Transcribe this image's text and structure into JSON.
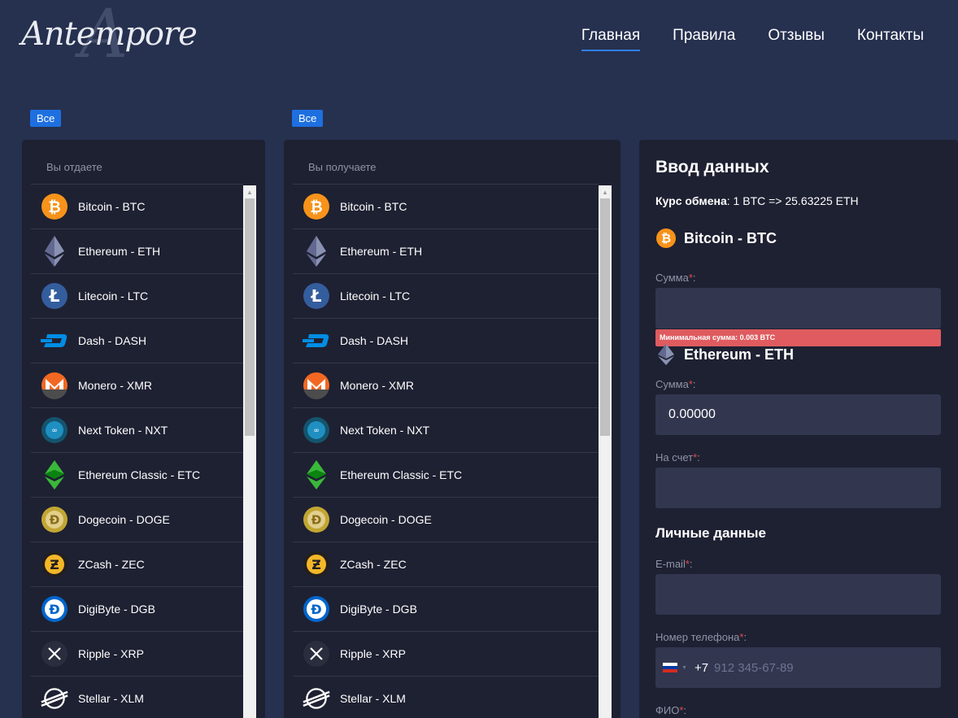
{
  "header": {
    "logo_text": "Antempore",
    "logo_initial": "A",
    "nav": [
      {
        "label": "Главная",
        "active": true
      },
      {
        "label": "Правила",
        "active": false
      },
      {
        "label": "Отзывы",
        "active": false
      },
      {
        "label": "Контакты",
        "active": false
      }
    ]
  },
  "give": {
    "filter_label": "Все",
    "title": "Вы отдаете"
  },
  "get": {
    "filter_label": "Все",
    "title": "Вы получаете"
  },
  "currencies": [
    {
      "label": "Bitcoin - BTC",
      "icon": "bitcoin-icon",
      "color": "#f7931a"
    },
    {
      "label": "Ethereum - ETH",
      "icon": "ethereum-icon",
      "color": "#8a92b2"
    },
    {
      "label": "Litecoin - LTC",
      "icon": "litecoin-icon",
      "color": "#345d9d"
    },
    {
      "label": "Dash - DASH",
      "icon": "dash-icon",
      "color": "#008de4"
    },
    {
      "label": "Monero - XMR",
      "icon": "monero-icon",
      "color": "#f26822"
    },
    {
      "label": "Next Token - NXT",
      "icon": "nxt-icon",
      "color": "#008fbb"
    },
    {
      "label": "Ethereum Classic - ETC",
      "icon": "ethereum-classic-icon",
      "color": "#3ab83a"
    },
    {
      "label": "Dogecoin - DOGE",
      "icon": "dogecoin-icon",
      "color": "#c2a633"
    },
    {
      "label": "ZCash - ZEC",
      "icon": "zcash-icon",
      "color": "#f4b728"
    },
    {
      "label": "DigiByte - DGB",
      "icon": "digibyte-icon",
      "color": "#0066cc"
    },
    {
      "label": "Ripple - XRP",
      "icon": "ripple-icon",
      "color": "#ffffff"
    },
    {
      "label": "Stellar - XLM",
      "icon": "stellar-icon",
      "color": "#ffffff"
    }
  ],
  "form": {
    "title": "Ввод данных",
    "rate_label": "Курс обмена",
    "rate_value": ": 1 BTC => 25.63225 ETH",
    "give_currency": "Bitcoin - BTC",
    "amount_label": "Сумма",
    "required_mark": "*",
    "colon": ":",
    "give_amount_value": "",
    "min_amount_error": "Минимальная сумма: 0.003 BTC",
    "get_currency": "Ethereum - ETH",
    "get_amount_value": "0.00000",
    "account_label": "На счет",
    "account_value": "",
    "personal_title": "Личные данные",
    "email_label": "E-mail",
    "email_value": "",
    "phone_label": "Номер телефона",
    "phone_code": "+7",
    "phone_placeholder": "912 345-67-89",
    "fio_label": "ФИО"
  },
  "colors": {
    "background": "#26304f",
    "panel": "#1e2132",
    "input": "#32364f",
    "accent": "#1e6fe0",
    "error": "#df5b5f",
    "required": "#e5484d"
  }
}
